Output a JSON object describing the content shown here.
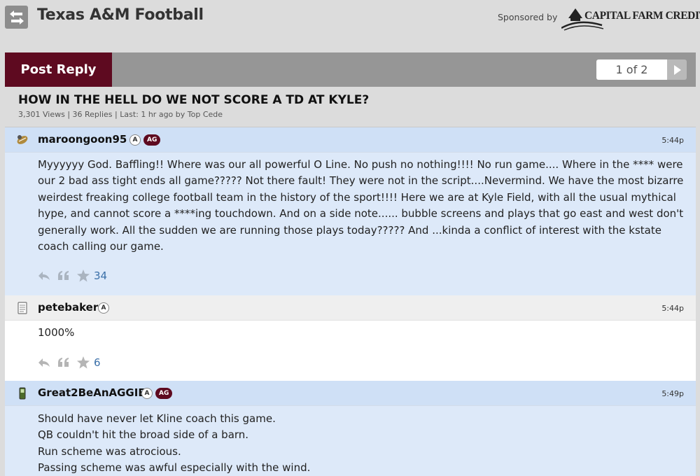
{
  "header": {
    "back_icon": "arrows-swap-icon",
    "title": "Texas A&M Football",
    "sponsored_label": "Sponsored by",
    "sponsor_name": "CAPITAL FARM CREDIT"
  },
  "toolbar": {
    "post_reply_label": "Post Reply",
    "page_indicator": "1 of 2",
    "next_icon": "triangle-right-icon"
  },
  "thread": {
    "title": "HOW IN THE HELL DO WE NOT SCORE A TD AT KYLE?",
    "meta": "3,301 Views | 36 Replies | Last: 1 hr ago by Top Cede"
  },
  "posts": [
    {
      "username": "maroongoon95",
      "badge_a": "A",
      "badge_ag": "AG",
      "time": "5:44p",
      "lines": [
        "Myyyyyy God. Baffling!! Where was our all powerful O Line. No push no nothing!!!! No run game.... Where in the **** were our 2 bad ass tight ends all game????? Not there fault! They were not in the script....Nevermind. We have the most bizarre weirdest freaking college football team in the history of the sport!!!! Here we are at Kyle Field, with all the usual mythical hype, and cannot score a ****ing touchdown. And on a side note...... bubble screens and plays that go east and west don't generally work. All the sudden we are running those plays today????? And ...kinda a conflict of interest with the kstate coach calling our game."
      ],
      "star_count": "34",
      "reply_icon": "reply-arrow-icon",
      "quote_icon": "quote-icon",
      "star_icon": "star-icon"
    },
    {
      "username": "petebaker",
      "badge_a": "A",
      "time": "5:44p",
      "lines": [
        "1000%"
      ],
      "star_count": "6"
    },
    {
      "username": "Great2BeAnAGGIE",
      "badge_a": "A",
      "badge_ag": "AG",
      "time": "5:49p",
      "lines": [
        "Should have never let Kline coach this game.",
        "QB couldn't hit the broad side of a barn.",
        "Run scheme was atrocious.",
        "Passing scheme was awful especially with the wind."
      ]
    }
  ],
  "colors": {
    "maroon": "#5e0a20",
    "post_blue": "#dde9f9",
    "post_head_blue": "#cfe0f6",
    "link_blue": "#3a6fa8"
  }
}
